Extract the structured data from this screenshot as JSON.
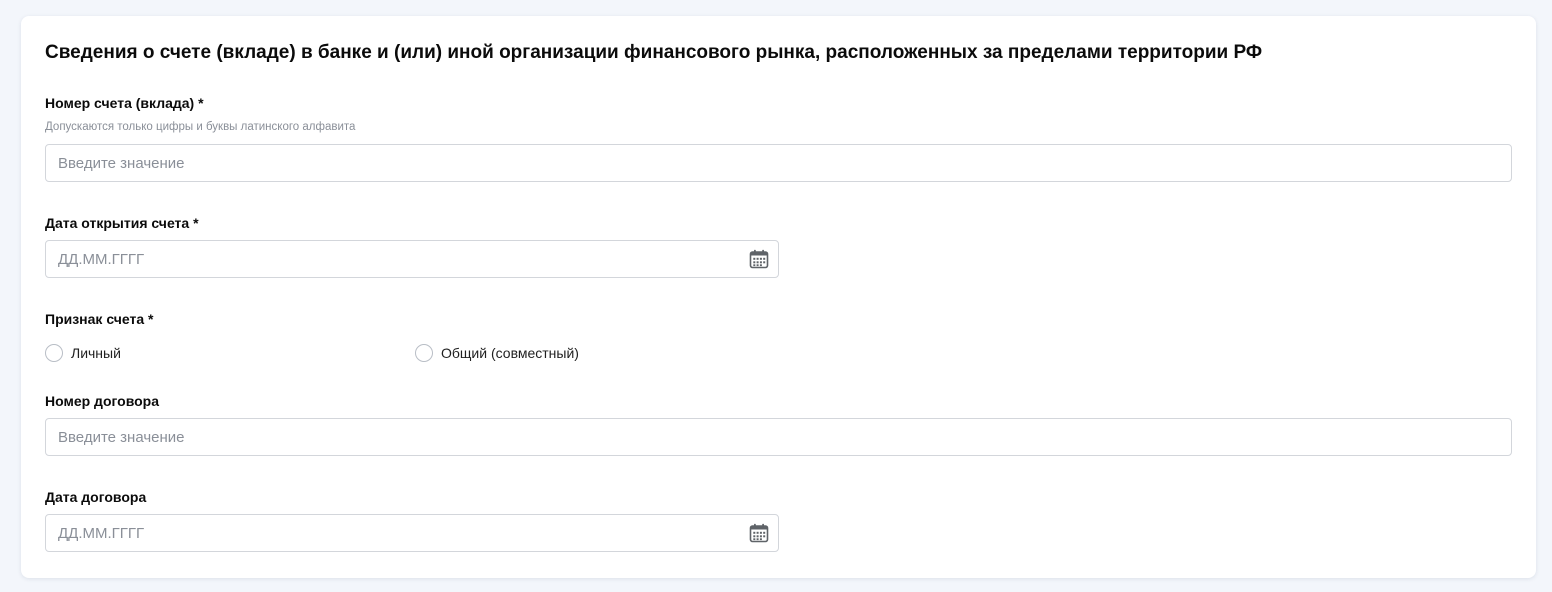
{
  "form": {
    "title": "Сведения о счете (вкладе) в банке и (или) иной организации финансового рынка, расположенных за пределами территории РФ",
    "account_number": {
      "label": "Номер счета (вклада) *",
      "hint": "Допускаются только цифры и буквы латинского алфавита",
      "placeholder": "Введите значение",
      "value": ""
    },
    "account_open_date": {
      "label": "Дата открытия счета *",
      "placeholder": "ДД.ММ.ГГГГ",
      "value": "",
      "icon": "calendar-icon"
    },
    "account_type": {
      "label": "Признак счета *",
      "options": [
        {
          "label": "Личный",
          "selected": false
        },
        {
          "label": "Общий (совместный)",
          "selected": false
        }
      ]
    },
    "contract_number": {
      "label": "Номер договора",
      "placeholder": "Введите значение",
      "value": ""
    },
    "contract_date": {
      "label": "Дата договора",
      "placeholder": "ДД.ММ.ГГГГ",
      "value": "",
      "icon": "calendar-icon"
    }
  },
  "colors": {
    "page_background": "#f3f6fb",
    "card_background": "#ffffff",
    "border": "#d3d6db",
    "placeholder": "#8a8f98",
    "icon": "#5f6368"
  }
}
